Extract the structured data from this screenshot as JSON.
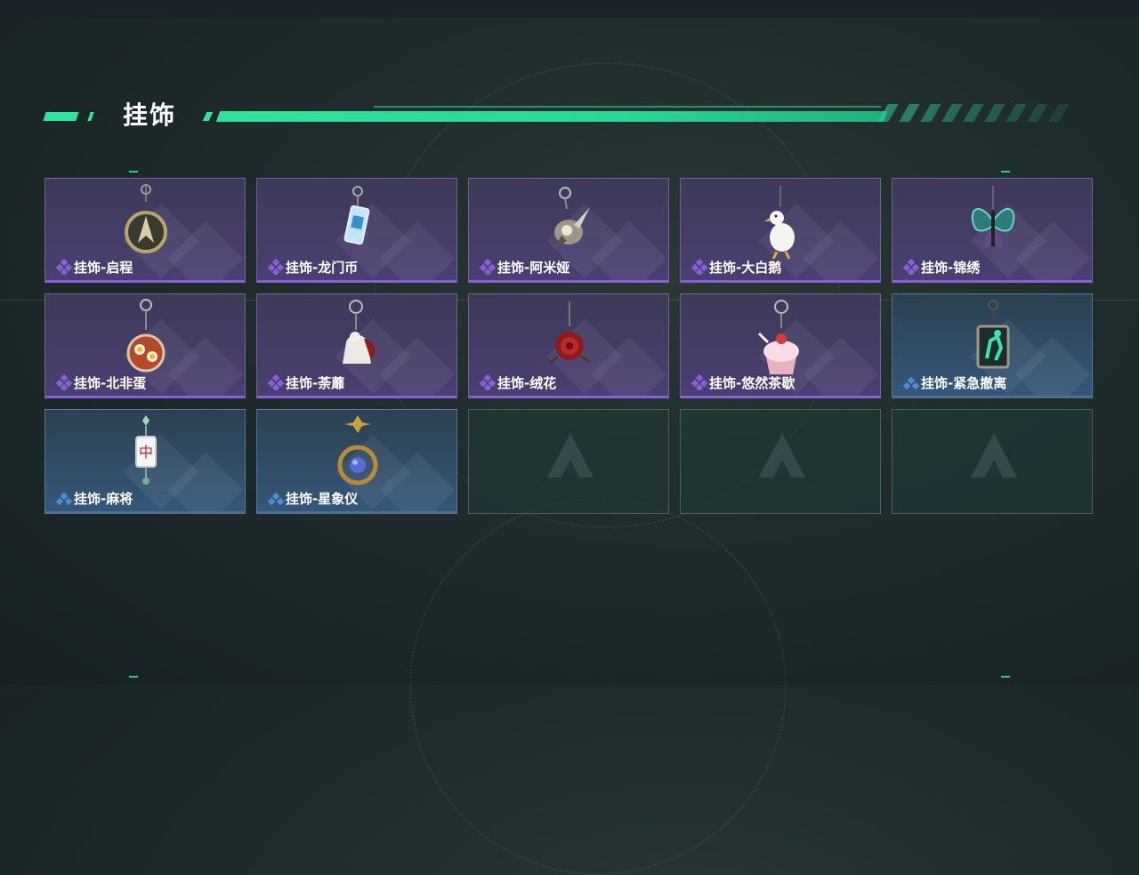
{
  "header": {
    "title": "挂饰"
  },
  "colors": {
    "accent": "#2fe39a",
    "purple_rarity": "#8a5ed6",
    "blue_rarity": "#4a8ed0"
  },
  "items": [
    {
      "label": "挂饰-启程",
      "rarity": "purple",
      "icon": "compass-charm-icon"
    },
    {
      "label": "挂饰-龙门币",
      "rarity": "purple",
      "icon": "coin-card-charm-icon"
    },
    {
      "label": "挂饰-阿米娅",
      "rarity": "purple",
      "icon": "amiya-charm-icon"
    },
    {
      "label": "挂饰-大白鹅",
      "rarity": "purple",
      "icon": "white-goose-charm-icon"
    },
    {
      "label": "挂饰-锦绣",
      "rarity": "purple",
      "icon": "butterfly-charm-icon"
    },
    {
      "label": "挂饰-北非蛋",
      "rarity": "purple",
      "icon": "shakshuka-charm-icon"
    },
    {
      "label": "挂饰-荼蘼",
      "rarity": "purple",
      "icon": "flower-doll-charm-icon"
    },
    {
      "label": "挂饰-绒花",
      "rarity": "purple",
      "icon": "red-rose-charm-icon"
    },
    {
      "label": "挂饰-悠然茶歇",
      "rarity": "purple",
      "icon": "cupcake-charm-icon"
    },
    {
      "label": "挂饰-紧急撤离",
      "rarity": "blue",
      "icon": "emergency-exit-charm-icon"
    },
    {
      "label": "挂饰-麻将",
      "rarity": "blue",
      "icon": "mahjong-tile-charm-icon"
    },
    {
      "label": "挂饰-星象仪",
      "rarity": "blue",
      "icon": "astrolabe-charm-icon"
    },
    {
      "label": "",
      "rarity": "empty",
      "icon": "empty-slot-logo-icon"
    },
    {
      "label": "",
      "rarity": "empty",
      "icon": "empty-slot-logo-icon"
    },
    {
      "label": "",
      "rarity": "empty",
      "icon": "empty-slot-logo-icon"
    }
  ]
}
